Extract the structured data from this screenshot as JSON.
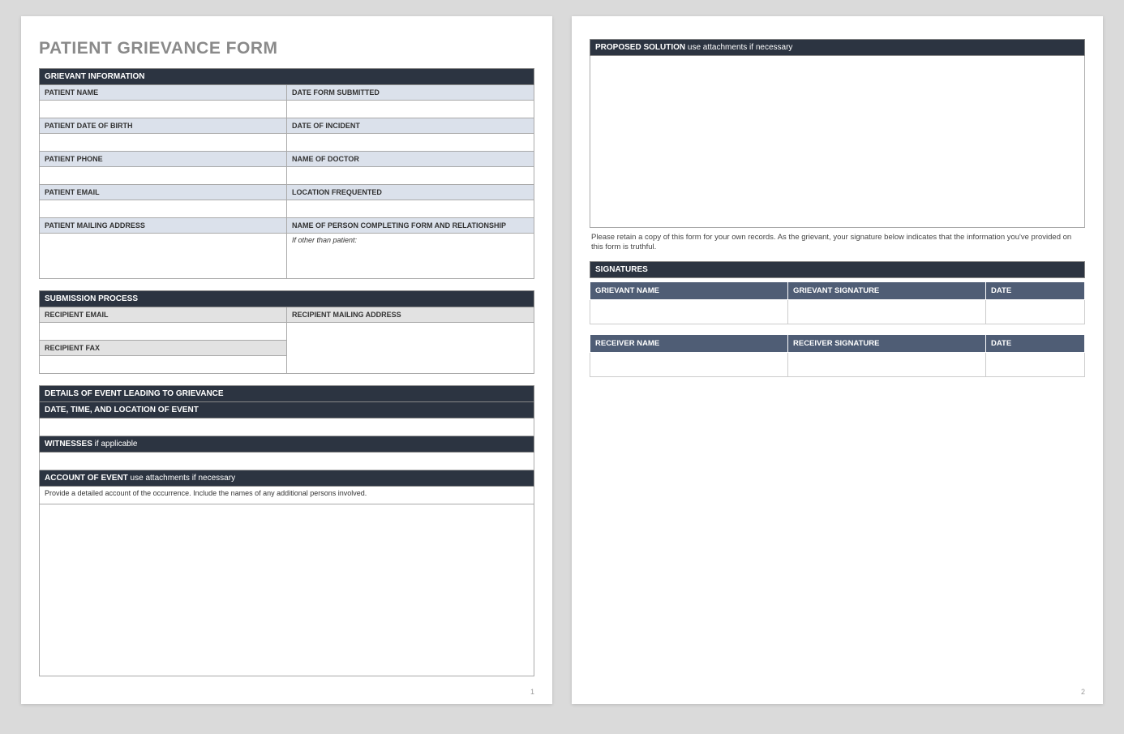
{
  "title": "PATIENT GRIEVANCE FORM",
  "page1_num": "1",
  "page2_num": "2",
  "grievant_info": {
    "header": "GRIEVANT INFORMATION",
    "patient_name": "PATIENT NAME",
    "date_submitted": "DATE FORM SUBMITTED",
    "dob": "PATIENT DATE OF BIRTH",
    "date_incident": "DATE OF INCIDENT",
    "phone": "PATIENT PHONE",
    "doctor": "NAME OF DOCTOR",
    "email": "PATIENT EMAIL",
    "location": "LOCATION FREQUENTED",
    "mailing": "PATIENT MAILING ADDRESS",
    "completing": "NAME OF PERSON COMPLETING FORM AND RELATIONSHIP",
    "if_other": "If other than patient:"
  },
  "submission": {
    "header": "SUBMISSION PROCESS",
    "rec_email": "RECIPIENT EMAIL",
    "rec_mail": "RECIPIENT MAILING ADDRESS",
    "rec_fax": "RECIPIENT FAX"
  },
  "details": {
    "header": "DETAILS OF EVENT LEADING TO GRIEVANCE",
    "datetime": "DATE, TIME, AND LOCATION OF EVENT",
    "witnesses": "WITNESSES",
    "witnesses_hint": " if applicable",
    "account": "ACCOUNT OF EVENT",
    "account_hint": "  use attachments if necessary",
    "instruction": "Provide a detailed account of the occurrence.  Include the names of any additional persons involved."
  },
  "solution": {
    "header": "PROPOSED SOLUTION",
    "hint": "  use attachments if necessary"
  },
  "disclaimer": "Please retain a copy of this form for your own records.  As the grievant, your signature below indicates that the information you've provided on this form is truthful.",
  "signatures": {
    "header": "SIGNATURES",
    "grievant_name": "GRIEVANT NAME",
    "grievant_sig": "GRIEVANT SIGNATURE",
    "receiver_name": "RECEIVER NAME",
    "receiver_sig": "RECEIVER SIGNATURE",
    "date": "DATE"
  }
}
